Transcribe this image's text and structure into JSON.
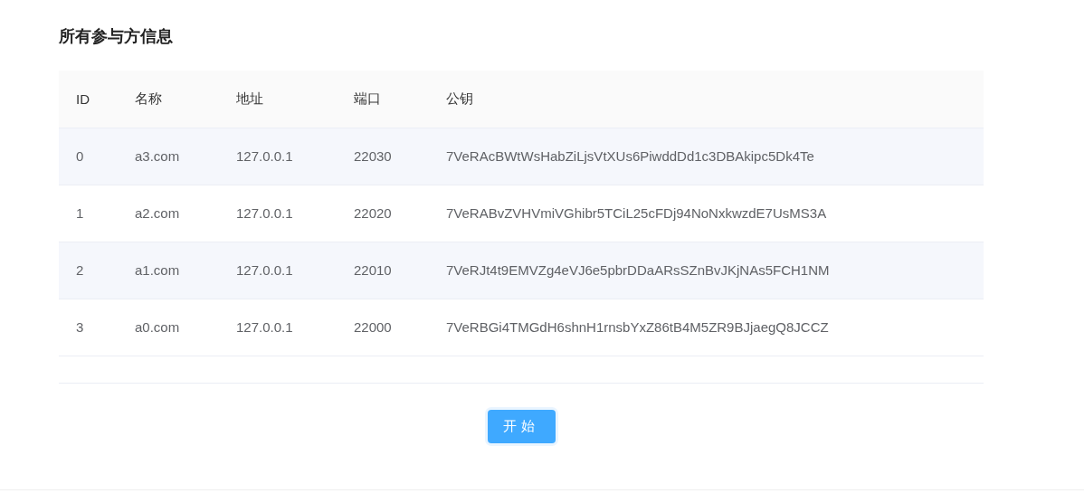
{
  "title": "所有参与方信息",
  "table": {
    "columns": [
      "ID",
      "名称",
      "地址",
      "端口",
      "公钥"
    ],
    "rows": [
      [
        "0",
        "a3.com",
        "127.0.0.1",
        "22030",
        "7VeRAcBWtWsHabZiLjsVtXUs6PiwddDd1c3DBAkipc5Dk4Te"
      ],
      [
        "1",
        "a2.com",
        "127.0.0.1",
        "22020",
        "7VeRABvZVHVmiVGhibr5TCiL25cFDj94NoNxkwzdE7UsMS3A"
      ],
      [
        "2",
        "a1.com",
        "127.0.0.1",
        "22010",
        "7VeRJt4t9EMVZg4eVJ6e5pbrDDaARsSZnBvJKjNAs5FCH1NM"
      ],
      [
        "3",
        "a0.com",
        "127.0.0.1",
        "22000",
        "7VeRBGi4TMGdH6shnH1rnsbYxZ86tB4M5ZR9BJjaegQ8JCCZ"
      ]
    ]
  },
  "button": "开始"
}
